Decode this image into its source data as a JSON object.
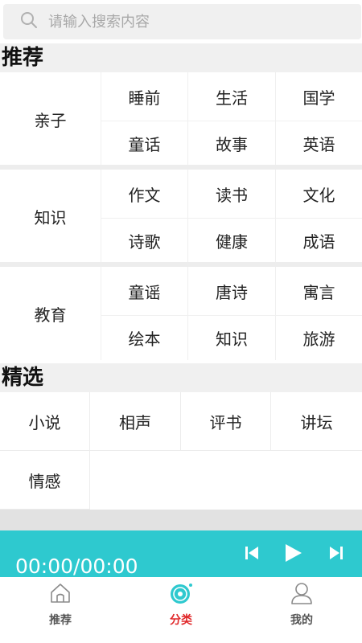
{
  "search": {
    "placeholder": "请输入搜索内容"
  },
  "recommend": {
    "title": "推荐",
    "groups": [
      {
        "label": "亲子",
        "items": [
          "睡前",
          "生活",
          "国学",
          "童话",
          "故事",
          "英语"
        ]
      },
      {
        "label": "知识",
        "items": [
          "作文",
          "读书",
          "文化",
          "诗歌",
          "健康",
          "成语"
        ]
      },
      {
        "label": "教育",
        "items": [
          "童谣",
          "唐诗",
          "寓言",
          "绘本",
          "知识",
          "旅游"
        ]
      }
    ]
  },
  "featured": {
    "title": "精选",
    "items": [
      "小说",
      "相声",
      "评书",
      "讲坛",
      "情感"
    ]
  },
  "player": {
    "time": "00:00/00:00"
  },
  "tabs": [
    {
      "label": "推荐",
      "icon": "home-icon"
    },
    {
      "label": "分类",
      "icon": "disc-icon",
      "active": true
    },
    {
      "label": "我的",
      "icon": "user-icon"
    }
  ],
  "colors": {
    "accent": "#2ec9cf",
    "active_tab": "#e0282a",
    "background": "#f0f0f0"
  }
}
